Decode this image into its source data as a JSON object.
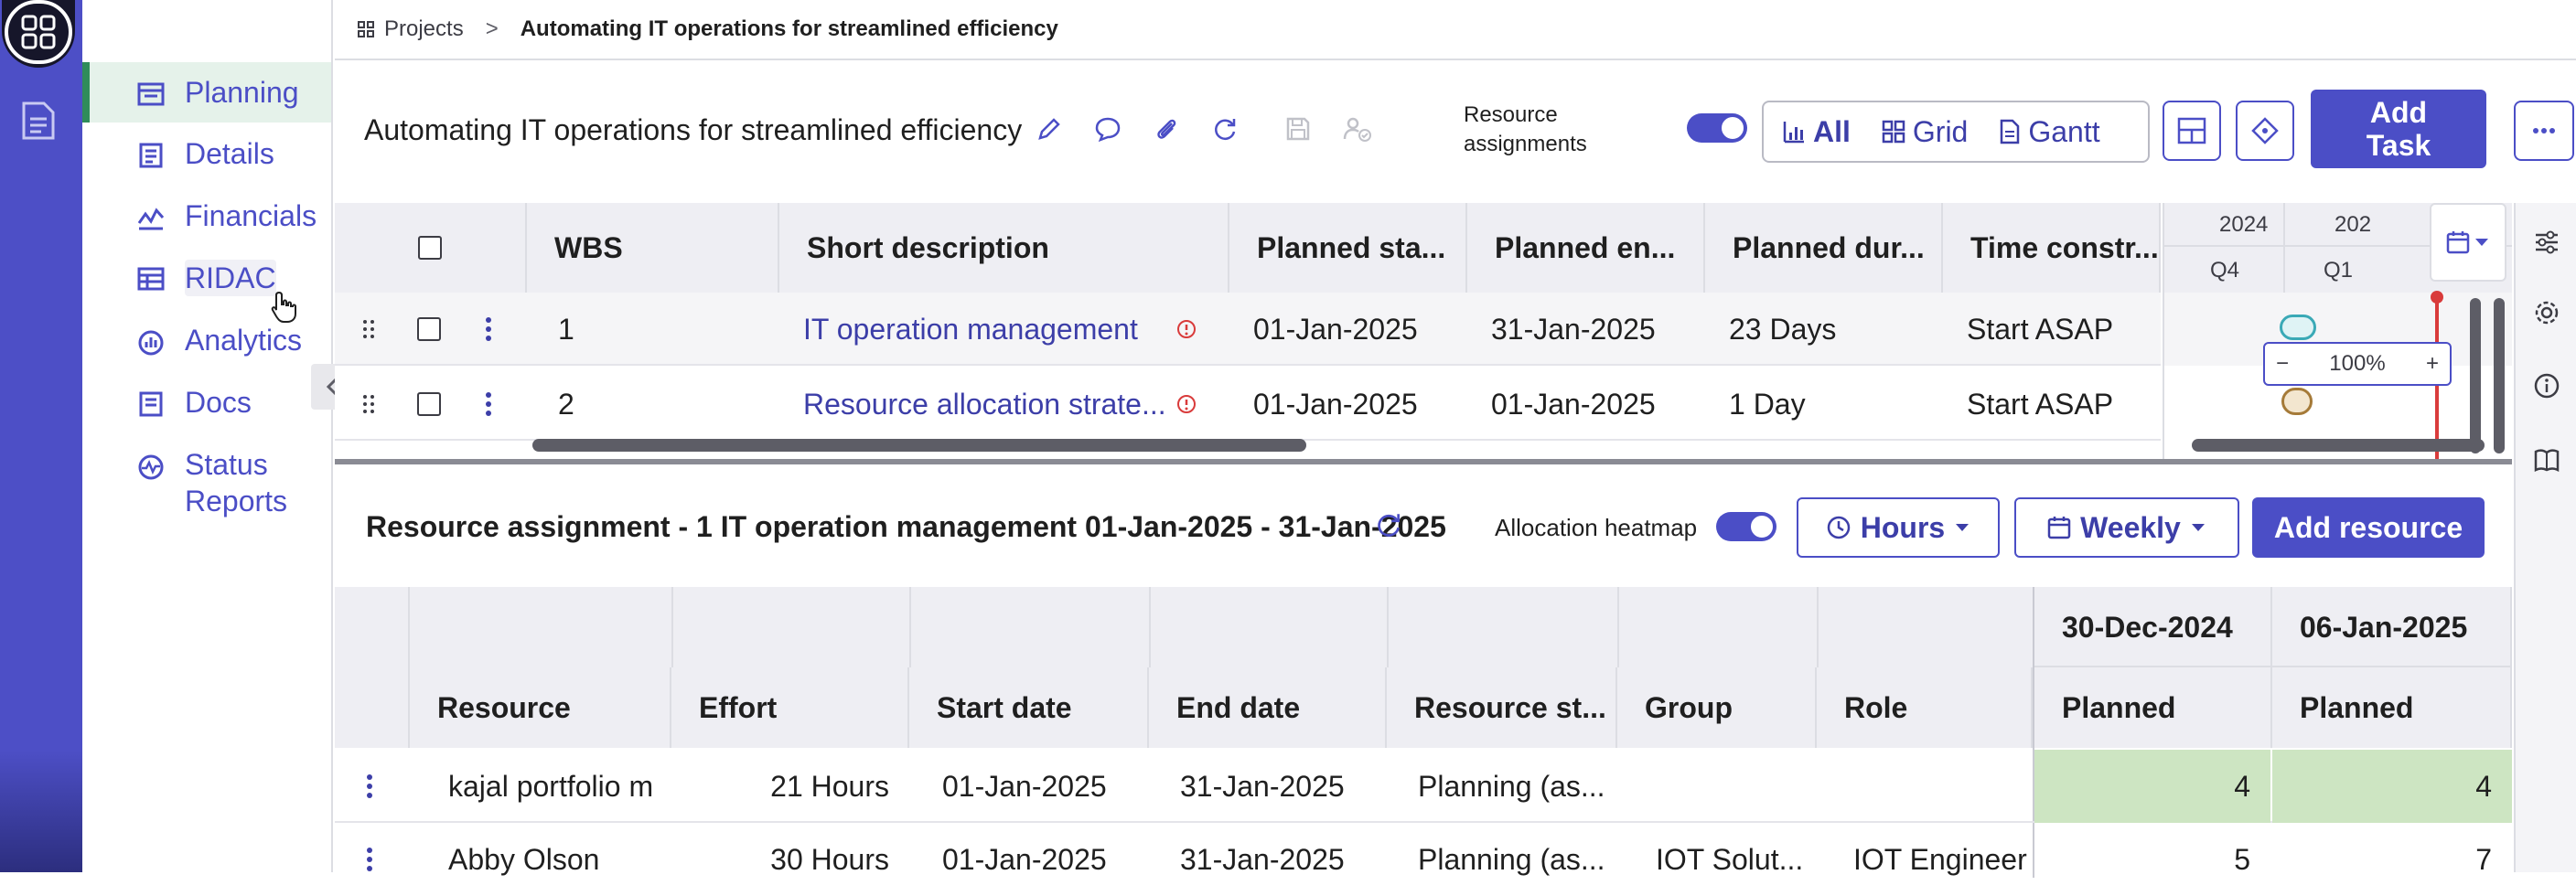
{
  "breadcrumb": {
    "root": "Projects",
    "separator": ">",
    "current": "Automating IT operations for streamlined efficiency"
  },
  "nav": {
    "items": [
      {
        "label": "Planning",
        "icon": "planning-icon"
      },
      {
        "label": "Details",
        "icon": "details-icon"
      },
      {
        "label": "Financials",
        "icon": "financials-icon"
      },
      {
        "label": "RIDAC",
        "icon": "ridac-icon"
      },
      {
        "label": "Analytics",
        "icon": "analytics-icon"
      },
      {
        "label": "Docs",
        "icon": "docs-icon"
      },
      {
        "label": "Status Reports",
        "icon": "status-reports-icon"
      }
    ],
    "active_index": 0
  },
  "header": {
    "title": "Automating IT operations for streamlined efficiency",
    "resource_assignments_label": "Resource assignments",
    "resource_assignments_on": true,
    "views": [
      {
        "label": "All",
        "icon": "chart-bar-icon",
        "selected": true
      },
      {
        "label": "Grid",
        "icon": "grid-icon",
        "selected": false
      },
      {
        "label": "Gantt",
        "icon": "document-icon",
        "selected": false
      }
    ],
    "add_task_label": "Add Task"
  },
  "task_grid": {
    "columns": [
      "WBS",
      "Short description",
      "Planned sta...",
      "Planned en...",
      "Planned dur...",
      "Time constr..."
    ],
    "rows": [
      {
        "wbs": "1",
        "description": "IT operation management",
        "start": "01-Jan-2025",
        "end": "31-Jan-2025",
        "duration": "23 Days",
        "constraint": "Start ASAP"
      },
      {
        "wbs": "2",
        "description": "Resource allocation strate...",
        "start": "01-Jan-2025",
        "end": "01-Jan-2025",
        "duration": "1 Day",
        "constraint": "Start ASAP"
      }
    ]
  },
  "gantt": {
    "years": [
      "2024",
      "202"
    ],
    "quarters": [
      "Q4",
      "Q1"
    ],
    "zoom": "100%",
    "zoom_minus": "−",
    "zoom_plus": "+"
  },
  "resource_panel": {
    "title": "Resource assignment - 1 IT operation management 01-Jan-2025 - 31-Jan-2025",
    "heatmap_label": "Allocation heatmap",
    "heatmap_on": true,
    "units_label": "Hours",
    "period_label": "Weekly",
    "add_resource_label": "Add resource",
    "columns": [
      "Resource",
      "Effort",
      "Start date",
      "End date",
      "Resource st...",
      "Group",
      "Role"
    ],
    "week_columns": [
      {
        "date": "30-Dec-2024",
        "sub": "Planned"
      },
      {
        "date": "06-Jan-2025",
        "sub": "Planned"
      }
    ],
    "rows": [
      {
        "resource": "kajal portfolio m",
        "effort": "21 Hours",
        "start": "01-Jan-2025",
        "end": "31-Jan-2025",
        "status": "Planning (as...",
        "group": "",
        "role": "",
        "week1": "4",
        "week2": "4"
      },
      {
        "resource": "Abby Olson",
        "effort": "30 Hours",
        "start": "01-Jan-2025",
        "end": "31-Jan-2025",
        "status": "Planning (as...",
        "group": "IOT Solut...",
        "role": "IOT Engineer",
        "week1": "5",
        "week2": "7"
      }
    ]
  },
  "colors": {
    "brand": "#4b4ec6",
    "rail": "#4d4fc6",
    "active_nav": "#e5f2ea",
    "heatmap_cell": "#cde5c2",
    "warning": "#d93b3b"
  }
}
